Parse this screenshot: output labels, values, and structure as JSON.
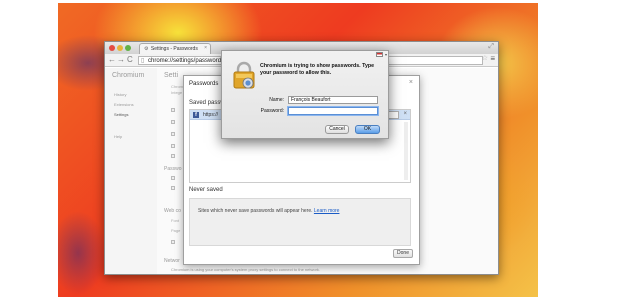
{
  "browser": {
    "tab_title": "Settings - Passwords",
    "tab_close": "×",
    "url": "chrome://settings/passwords",
    "nav_back": "←",
    "nav_forward": "→",
    "nav_reload": "C"
  },
  "settings_page": {
    "brand": "Chromium",
    "heading": "Setti",
    "sidebar": [
      "History",
      "Extensions",
      "Settings",
      "Help"
    ],
    "section_labels": [
      "Passwo",
      "Web co",
      "Networ"
    ],
    "background_lines": [
      "Chrom",
      "Intege",
      "Use",
      "Use",
      "Prot",
      "Enable",
      "Sen",
      "Ena",
      "Use",
      "Font",
      "Page",
      "Auto"
    ],
    "footer": "Chromium is using your computer's system proxy settings to connect to the network."
  },
  "passwords_dialog": {
    "title": "Passwords",
    "close": "×",
    "saved_label": "Saved passwords",
    "saved_site": "https://",
    "row_remove": "×",
    "never_saved_label": "Never saved",
    "never_saved_text": "Sites which never save passwords will appear here.",
    "learn_more": "Learn more",
    "done": "Done"
  },
  "auth_dialog": {
    "message": "Chromium is trying to show passwords. Type your password to allow this.",
    "name_label": "Name:",
    "name_value": "François Beaufort",
    "password_label": "Password:",
    "password_value": "",
    "cancel": "Cancel",
    "ok": "OK"
  }
}
